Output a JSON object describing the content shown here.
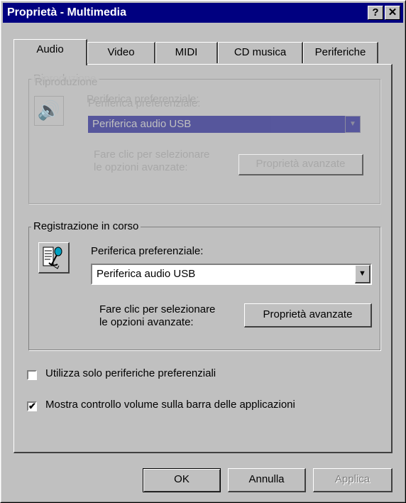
{
  "window": {
    "title": "Proprietà - Multimedia",
    "help_label": "?",
    "close_label": "✕"
  },
  "tabs": [
    {
      "label": "Audio",
      "active": true
    },
    {
      "label": "Video"
    },
    {
      "label": "MIDI"
    },
    {
      "label": "CD musica"
    },
    {
      "label": "Periferiche"
    }
  ],
  "playback": {
    "group_label": "Riproduzione",
    "device_label": "Periferica preferenziale:",
    "device_value": "Periferica audio USB",
    "help_text_line1": "Fare clic per selezionare",
    "help_text_line2": "le opzioni avanzate:",
    "advanced_button": "Proprietà avanzate",
    "icon": "speaker-icon"
  },
  "recording": {
    "group_label": "Registrazione in corso",
    "device_label": "Periferica preferenziale:",
    "device_value": "Periferica audio USB",
    "help_text_line1": "Fare clic per selezionare",
    "help_text_line2": "le opzioni avanzate:",
    "advanced_button": "Proprietà avanzate",
    "icon": "microphone-icon"
  },
  "options": {
    "preferred_only": {
      "label": "Utilizza solo periferiche preferenziali",
      "checked": false
    },
    "show_volume": {
      "label": "Mostra controllo volume sulla barra delle applicazioni",
      "checked": true
    }
  },
  "buttons": {
    "ok": "OK",
    "cancel": "Annulla",
    "apply": "Applica"
  },
  "colors": {
    "title_bar": "#000080",
    "face": "#c0c0c0",
    "disabled_text": "#808080"
  }
}
